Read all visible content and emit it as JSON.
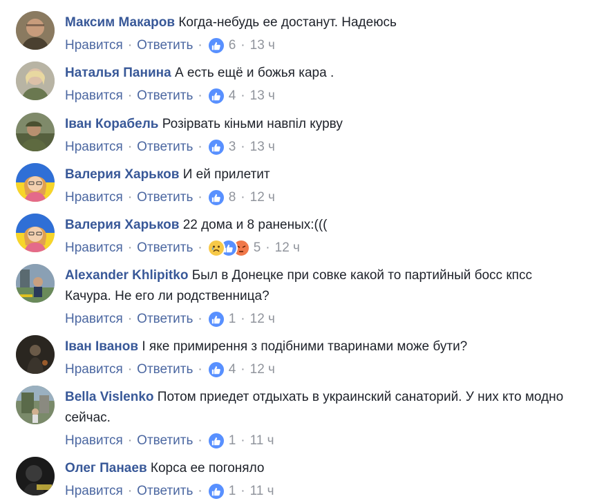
{
  "comments": [
    {
      "author": "Максим Макаров",
      "text": "Когда-небудь ее достанут. Надеюсь",
      "like_label": "Нравится",
      "reply_label": "Ответить",
      "reactions": [
        "like"
      ],
      "count": "6",
      "time": "13 ч",
      "avatar": "man-bald"
    },
    {
      "author": "Наталья Панина",
      "text": "А есть ещё и божья кара .",
      "like_label": "Нравится",
      "reply_label": "Ответить",
      "reactions": [
        "like"
      ],
      "count": "4",
      "time": "13 ч",
      "avatar": "woman-blonde"
    },
    {
      "author": "Іван Корабель",
      "text": "Розірвать кіньми навпіл курву",
      "like_label": "Нравится",
      "reply_label": "Ответить",
      "reactions": [
        "like"
      ],
      "count": "3",
      "time": "13 ч",
      "avatar": "soldier"
    },
    {
      "author": "Валерия Харьков",
      "text": "И ей прилетит",
      "like_label": "Нравится",
      "reply_label": "Ответить",
      "reactions": [
        "like"
      ],
      "count": "8",
      "time": "12 ч",
      "avatar": "cartoon-woman"
    },
    {
      "author": "Валерия Харьков",
      "text": "22 дома и 8 раненых:(((",
      "like_label": "Нравится",
      "reply_label": "Ответить",
      "reactions": [
        "sad",
        "like",
        "angry"
      ],
      "count": "5",
      "time": "12 ч",
      "avatar": "cartoon-woman"
    },
    {
      "author": "Alexander Khlipitko",
      "text": "Был в Донецке при совке какой то партийный босс кпсс Качура. Не его ли родственница?",
      "like_label": "Нравится",
      "reply_label": "Ответить",
      "reactions": [
        "like"
      ],
      "count": "1",
      "time": "12 ч",
      "avatar": "man-outdoors"
    },
    {
      "author": "Іван Іванов",
      "text": "І яке примирення з подібними тваринами може бути?",
      "like_label": "Нравится",
      "reply_label": "Ответить",
      "reactions": [
        "like"
      ],
      "count": "4",
      "time": "12 ч",
      "avatar": "dark-figure"
    },
    {
      "author": "Bella Vislenko",
      "text": "Потом приедет отдыхать в украинский санаторий. У них кто модно сейчас.",
      "like_label": "Нравится",
      "reply_label": "Ответить",
      "reactions": [
        "like"
      ],
      "count": "1",
      "time": "11 ч",
      "avatar": "landscape"
    },
    {
      "author": "Олег Панаев",
      "text": "Корса ее погоняло",
      "like_label": "Нравится",
      "reply_label": "Ответить",
      "reactions": [
        "like"
      ],
      "count": "1",
      "time": "11 ч",
      "avatar": "dark-logo"
    }
  ],
  "colors": {
    "author": "#385898",
    "link": "#4b67a1",
    "meta": "#90949c",
    "like": "#5890ff"
  }
}
